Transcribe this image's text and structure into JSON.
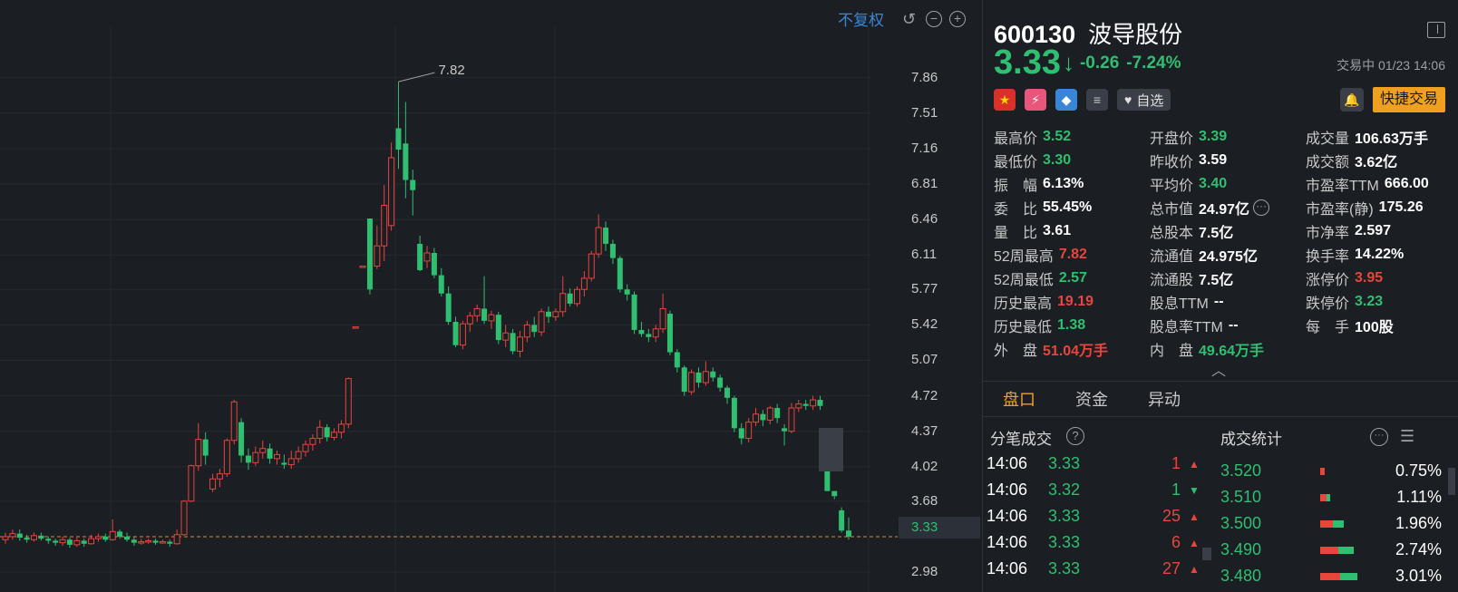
{
  "chart": {
    "no_adjust_label": "不复权",
    "reset_icon": "undo-icon",
    "zoom_out_icon": "minus-circle-icon",
    "zoom_in_icon": "plus-circle-icon",
    "price_axis": [
      "7.86",
      "7.51",
      "7.16",
      "6.81",
      "6.46",
      "6.11",
      "5.77",
      "5.42",
      "5.07",
      "4.72",
      "4.37",
      "4.02",
      "3.68",
      "2.98"
    ],
    "current_price_tag": "3.33",
    "high_marker_label": "7.82",
    "colors": {
      "up": "#e8453c",
      "down": "#2fbf71",
      "current_line": "#d48a3a",
      "grid": "#262a30"
    }
  },
  "chart_data": {
    "type": "candlestick",
    "y_range": [
      2.9,
      8.0
    ],
    "current_price": 3.33,
    "high_marker": 7.82,
    "candles": [
      {
        "o": 3.3,
        "c": 3.33,
        "h": 3.37,
        "l": 3.26
      },
      {
        "o": 3.33,
        "c": 3.36,
        "h": 3.4,
        "l": 3.3
      },
      {
        "o": 3.36,
        "c": 3.32,
        "h": 3.4,
        "l": 3.29
      },
      {
        "o": 3.32,
        "c": 3.3,
        "h": 3.35,
        "l": 3.27
      },
      {
        "o": 3.3,
        "c": 3.34,
        "h": 3.37,
        "l": 3.28
      },
      {
        "o": 3.34,
        "c": 3.31,
        "h": 3.37,
        "l": 3.29
      },
      {
        "o": 3.31,
        "c": 3.29,
        "h": 3.33,
        "l": 3.26
      },
      {
        "o": 3.29,
        "c": 3.27,
        "h": 3.31,
        "l": 3.24
      },
      {
        "o": 3.27,
        "c": 3.3,
        "h": 3.33,
        "l": 3.24
      },
      {
        "o": 3.3,
        "c": 3.25,
        "h": 3.32,
        "l": 3.22
      },
      {
        "o": 3.25,
        "c": 3.29,
        "h": 3.32,
        "l": 3.23
      },
      {
        "o": 3.29,
        "c": 3.26,
        "h": 3.31,
        "l": 3.23
      },
      {
        "o": 3.26,
        "c": 3.31,
        "h": 3.35,
        "l": 3.25
      },
      {
        "o": 3.31,
        "c": 3.33,
        "h": 3.36,
        "l": 3.28
      },
      {
        "o": 3.33,
        "c": 3.3,
        "h": 3.36,
        "l": 3.28
      },
      {
        "o": 3.3,
        "c": 3.38,
        "h": 3.5,
        "l": 3.29
      },
      {
        "o": 3.38,
        "c": 3.33,
        "h": 3.4,
        "l": 3.31
      },
      {
        "o": 3.33,
        "c": 3.3,
        "h": 3.37,
        "l": 3.28
      },
      {
        "o": 3.3,
        "c": 3.27,
        "h": 3.33,
        "l": 3.24
      },
      {
        "o": 3.27,
        "c": 3.28,
        "h": 3.31,
        "l": 3.25
      },
      {
        "o": 3.28,
        "c": 3.29,
        "h": 3.31,
        "l": 3.26
      },
      {
        "o": 3.29,
        "c": 3.27,
        "h": 3.31,
        "l": 3.25
      },
      {
        "o": 3.27,
        "c": 3.28,
        "h": 3.3,
        "l": 3.26
      },
      {
        "o": 3.28,
        "c": 3.26,
        "h": 3.3,
        "l": 3.23
      },
      {
        "o": 3.26,
        "c": 3.35,
        "h": 3.4,
        "l": 3.25
      },
      {
        "o": 3.35,
        "c": 3.68,
        "h": 3.69,
        "l": 3.34
      },
      {
        "o": 3.68,
        "c": 4.03,
        "h": 4.04,
        "l": 3.67
      },
      {
        "o": 4.03,
        "c": 4.29,
        "h": 4.45,
        "l": 3.98
      },
      {
        "o": 4.29,
        "c": 4.13,
        "h": 4.36,
        "l": 4.04
      },
      {
        "o": 3.8,
        "c": 3.9,
        "h": 3.95,
        "l": 3.77
      },
      {
        "o": 3.9,
        "c": 3.95,
        "h": 4.0,
        "l": 3.82
      },
      {
        "o": 3.95,
        "c": 4.28,
        "h": 4.3,
        "l": 3.92
      },
      {
        "o": 4.28,
        "c": 4.66,
        "h": 4.68,
        "l": 4.24
      },
      {
        "o": 4.46,
        "c": 4.13,
        "h": 4.5,
        "l": 4.06
      },
      {
        "o": 4.13,
        "c": 4.06,
        "h": 4.2,
        "l": 3.99
      },
      {
        "o": 4.06,
        "c": 4.16,
        "h": 4.22,
        "l": 4.03
      },
      {
        "o": 4.16,
        "c": 4.2,
        "h": 4.28,
        "l": 4.1
      },
      {
        "o": 4.2,
        "c": 4.1,
        "h": 4.25,
        "l": 4.05
      },
      {
        "o": 4.1,
        "c": 4.14,
        "h": 4.18,
        "l": 4.04
      },
      {
        "o": 4.06,
        "c": 4.04,
        "h": 4.14,
        "l": 4.0
      },
      {
        "o": 4.04,
        "c": 4.1,
        "h": 4.18,
        "l": 4.0
      },
      {
        "o": 4.1,
        "c": 4.17,
        "h": 4.22,
        "l": 4.06
      },
      {
        "o": 4.17,
        "c": 4.24,
        "h": 4.28,
        "l": 4.12
      },
      {
        "o": 4.24,
        "c": 4.3,
        "h": 4.34,
        "l": 4.18
      },
      {
        "o": 4.3,
        "c": 4.41,
        "h": 4.48,
        "l": 4.25
      },
      {
        "o": 4.41,
        "c": 4.31,
        "h": 4.44,
        "l": 4.27
      },
      {
        "o": 4.31,
        "c": 4.36,
        "h": 4.4,
        "l": 4.28
      },
      {
        "o": 4.36,
        "c": 4.44,
        "h": 4.48,
        "l": 4.3
      },
      {
        "o": 4.44,
        "c": 4.89,
        "h": 4.9,
        "l": 4.4
      },
      {
        "o": 5.4,
        "c": 5.4,
        "h": 5.4,
        "l": 5.4
      },
      {
        "o": 6.0,
        "c": 6.0,
        "h": 6.0,
        "l": 6.0
      },
      {
        "o": 6.47,
        "c": 5.77,
        "h": 6.47,
        "l": 5.72
      },
      {
        "o": 6.0,
        "c": 6.2,
        "h": 6.4,
        "l": 5.97
      },
      {
        "o": 6.2,
        "c": 6.6,
        "h": 6.8,
        "l": 6.05
      },
      {
        "o": 6.4,
        "c": 7.07,
        "h": 7.22,
        "l": 6.35
      },
      {
        "o": 7.36,
        "c": 7.15,
        "h": 7.82,
        "l": 6.96
      },
      {
        "o": 7.21,
        "c": 6.85,
        "h": 7.62,
        "l": 6.67
      },
      {
        "o": 6.85,
        "c": 6.75,
        "h": 6.95,
        "l": 6.5
      },
      {
        "o": 6.22,
        "c": 5.96,
        "h": 6.3,
        "l": 5.95
      },
      {
        "o": 6.05,
        "c": 6.13,
        "h": 6.2,
        "l": 5.98
      },
      {
        "o": 6.13,
        "c": 5.91,
        "h": 6.18,
        "l": 5.88
      },
      {
        "o": 5.91,
        "c": 5.73,
        "h": 5.98,
        "l": 5.7
      },
      {
        "o": 5.73,
        "c": 5.45,
        "h": 5.8,
        "l": 5.42
      },
      {
        "o": 5.45,
        "c": 5.22,
        "h": 5.5,
        "l": 5.2
      },
      {
        "o": 5.22,
        "c": 5.43,
        "h": 5.46,
        "l": 5.18
      },
      {
        "o": 5.43,
        "c": 5.51,
        "h": 5.55,
        "l": 5.35
      },
      {
        "o": 5.51,
        "c": 5.58,
        "h": 5.62,
        "l": 5.45
      },
      {
        "o": 5.58,
        "c": 5.46,
        "h": 5.9,
        "l": 5.43
      },
      {
        "o": 5.46,
        "c": 5.52,
        "h": 5.56,
        "l": 5.38
      },
      {
        "o": 5.52,
        "c": 5.27,
        "h": 5.55,
        "l": 5.23
      },
      {
        "o": 5.27,
        "c": 5.34,
        "h": 5.42,
        "l": 5.2
      },
      {
        "o": 5.34,
        "c": 5.16,
        "h": 5.38,
        "l": 5.13
      },
      {
        "o": 5.16,
        "c": 5.3,
        "h": 5.36,
        "l": 5.1
      },
      {
        "o": 5.3,
        "c": 5.42,
        "h": 5.46,
        "l": 5.25
      },
      {
        "o": 5.42,
        "c": 5.35,
        "h": 5.5,
        "l": 5.3
      },
      {
        "o": 5.35,
        "c": 5.55,
        "h": 5.58,
        "l": 5.31
      },
      {
        "o": 5.55,
        "c": 5.5,
        "h": 5.6,
        "l": 5.44
      },
      {
        "o": 5.5,
        "c": 5.55,
        "h": 5.58,
        "l": 5.46
      },
      {
        "o": 5.55,
        "c": 5.73,
        "h": 5.9,
        "l": 5.5
      },
      {
        "o": 5.73,
        "c": 5.63,
        "h": 5.78,
        "l": 5.6
      },
      {
        "o": 5.63,
        "c": 5.77,
        "h": 5.8,
        "l": 5.6
      },
      {
        "o": 5.77,
        "c": 5.88,
        "h": 5.95,
        "l": 5.7
      },
      {
        "o": 5.88,
        "c": 6.12,
        "h": 6.15,
        "l": 5.85
      },
      {
        "o": 6.12,
        "c": 6.38,
        "h": 6.51,
        "l": 6.08
      },
      {
        "o": 6.38,
        "c": 6.22,
        "h": 6.44,
        "l": 6.15
      },
      {
        "o": 6.22,
        "c": 6.08,
        "h": 6.26,
        "l": 6.02
      },
      {
        "o": 6.08,
        "c": 5.77,
        "h": 6.1,
        "l": 5.74
      },
      {
        "o": 5.77,
        "c": 5.72,
        "h": 5.82,
        "l": 5.66
      },
      {
        "o": 5.72,
        "c": 5.37,
        "h": 5.75,
        "l": 5.33
      },
      {
        "o": 5.37,
        "c": 5.33,
        "h": 5.45,
        "l": 5.3
      },
      {
        "o": 5.33,
        "c": 5.3,
        "h": 5.38,
        "l": 5.25
      },
      {
        "o": 5.3,
        "c": 5.38,
        "h": 5.42,
        "l": 5.25
      },
      {
        "o": 5.38,
        "c": 5.58,
        "h": 5.73,
        "l": 5.34
      },
      {
        "o": 5.53,
        "c": 5.15,
        "h": 5.56,
        "l": 5.12
      },
      {
        "o": 5.15,
        "c": 5.0,
        "h": 5.18,
        "l": 4.95
      },
      {
        "o": 5.0,
        "c": 4.76,
        "h": 5.02,
        "l": 4.72
      },
      {
        "o": 4.76,
        "c": 4.95,
        "h": 4.98,
        "l": 4.73
      },
      {
        "o": 4.95,
        "c": 4.85,
        "h": 5.0,
        "l": 4.8
      },
      {
        "o": 4.85,
        "c": 4.96,
        "h": 5.06,
        "l": 4.82
      },
      {
        "o": 4.96,
        "c": 4.9,
        "h": 5.0,
        "l": 4.86
      },
      {
        "o": 4.9,
        "c": 4.8,
        "h": 4.93,
        "l": 4.76
      },
      {
        "o": 4.8,
        "c": 4.7,
        "h": 4.82,
        "l": 4.64
      },
      {
        "o": 4.7,
        "c": 4.4,
        "h": 4.72,
        "l": 4.36
      },
      {
        "o": 4.4,
        "c": 4.3,
        "h": 4.45,
        "l": 4.24
      },
      {
        "o": 4.3,
        "c": 4.46,
        "h": 4.5,
        "l": 4.26
      },
      {
        "o": 4.46,
        "c": 4.54,
        "h": 4.6,
        "l": 4.42
      },
      {
        "o": 4.54,
        "c": 4.48,
        "h": 4.58,
        "l": 4.42
      },
      {
        "o": 4.48,
        "c": 4.6,
        "h": 4.62,
        "l": 4.44
      },
      {
        "o": 4.6,
        "c": 4.5,
        "h": 4.64,
        "l": 4.45
      },
      {
        "o": 4.4,
        "c": 4.37,
        "h": 4.44,
        "l": 4.23
      },
      {
        "o": 4.37,
        "c": 4.6,
        "h": 4.65,
        "l": 4.35
      },
      {
        "o": 4.6,
        "c": 4.64,
        "h": 4.68,
        "l": 4.56
      },
      {
        "o": 4.64,
        "c": 4.62,
        "h": 4.68,
        "l": 4.58
      },
      {
        "o": 4.62,
        "c": 4.68,
        "h": 4.72,
        "l": 4.58
      },
      {
        "o": 4.68,
        "c": 4.62,
        "h": 4.72,
        "l": 4.58
      },
      {
        "o": 4.24,
        "c": 3.78,
        "h": 4.24,
        "l": 3.78
      },
      {
        "o": 3.78,
        "c": 3.73,
        "h": 3.78,
        "l": 3.7
      },
      {
        "o": 3.59,
        "c": 3.39,
        "h": 3.62,
        "l": 3.37
      },
      {
        "o": 3.39,
        "c": 3.33,
        "h": 3.52,
        "l": 3.3
      }
    ]
  },
  "quote": {
    "code": "600130",
    "name": "波导股份",
    "price": "3.33",
    "change": "-0.26",
    "change_pct": "-7.24%",
    "status": "交易中 01/23 14:06",
    "watch_label": "自选",
    "quick_trade_label": "快捷交易",
    "icons": {
      "collapse": "panel-collapse-icon",
      "flag": "china-flag-icon",
      "bolt": "lightning-icon",
      "tag": "price-tag-icon",
      "doc": "document-icon",
      "heart": "heart-icon",
      "bell": "bell-icon"
    }
  },
  "stats": [
    [
      {
        "label": "最高价",
        "value": "3.52",
        "color": "green"
      },
      {
        "label": "开盘价",
        "value": "3.39",
        "color": "green"
      },
      {
        "label": "成交量",
        "value": "106.63万手",
        "color": "white"
      }
    ],
    [
      {
        "label": "最低价",
        "value": "3.30",
        "color": "green"
      },
      {
        "label": "昨收价",
        "value": "3.59",
        "color": "white"
      },
      {
        "label": "成交额",
        "value": "3.62亿",
        "color": "white"
      }
    ],
    [
      {
        "label": "振　幅",
        "value": "6.13%",
        "color": "white"
      },
      {
        "label": "平均价",
        "value": "3.40",
        "color": "green"
      },
      {
        "label": "市盈率TTM",
        "value": "666.00",
        "color": "white"
      }
    ],
    [
      {
        "label": "委　比",
        "value": "55.45%",
        "color": "white"
      },
      {
        "label": "总市值",
        "value": "24.97亿",
        "color": "white",
        "more": true
      },
      {
        "label": "市盈率(静)",
        "value": "175.26",
        "color": "white"
      }
    ],
    [
      {
        "label": "量　比",
        "value": "3.61",
        "color": "white"
      },
      {
        "label": "总股本",
        "value": "7.5亿",
        "color": "white"
      },
      {
        "label": "市净率",
        "value": "2.597",
        "color": "white"
      }
    ],
    [
      {
        "label": "52周最高",
        "value": "7.82",
        "color": "red"
      },
      {
        "label": "流通值",
        "value": "24.975亿",
        "color": "white"
      },
      {
        "label": "换手率",
        "value": "14.22%",
        "color": "white"
      }
    ],
    [
      {
        "label": "52周最低",
        "value": "2.57",
        "color": "green"
      },
      {
        "label": "流通股",
        "value": "7.5亿",
        "color": "white"
      },
      {
        "label": "涨停价",
        "value": "3.95",
        "color": "red"
      }
    ],
    [
      {
        "label": "历史最高",
        "value": "19.19",
        "color": "red"
      },
      {
        "label": "股息TTM",
        "value": "--",
        "color": "white"
      },
      {
        "label": "跌停价",
        "value": "3.23",
        "color": "green"
      }
    ],
    [
      {
        "label": "历史最低",
        "value": "1.38",
        "color": "green"
      },
      {
        "label": "股息率TTM",
        "value": "--",
        "color": "white"
      },
      {
        "label": "每　手",
        "value": "100股",
        "color": "white"
      }
    ],
    [
      {
        "label": "外　盘",
        "value": "51.04万手",
        "color": "red"
      },
      {
        "label": "内　盘",
        "value": "49.64万手",
        "color": "green"
      },
      {
        "label": "",
        "value": "",
        "color": "white"
      }
    ]
  ],
  "tabs": [
    "盘口",
    "资金",
    "异动"
  ],
  "ticks": {
    "title": "分笔成交",
    "rows": [
      {
        "time": "14:06",
        "price": "3.33",
        "vol": "1",
        "dir": "up"
      },
      {
        "time": "14:06",
        "price": "3.32",
        "vol": "1",
        "dir": "down"
      },
      {
        "time": "14:06",
        "price": "3.33",
        "vol": "25",
        "dir": "up"
      },
      {
        "time": "14:06",
        "price": "3.33",
        "vol": "6",
        "dir": "up"
      },
      {
        "time": "14:06",
        "price": "3.33",
        "vol": "27",
        "dir": "up"
      }
    ]
  },
  "volume_stats": {
    "title": "成交统计",
    "rows": [
      {
        "price": "3.520",
        "pct": "0.75%",
        "red": 0.04,
        "green": 0.0
      },
      {
        "price": "3.510",
        "pct": "1.11%",
        "red": 0.06,
        "green": 0.03
      },
      {
        "price": "3.500",
        "pct": "1.96%",
        "red": 0.12,
        "green": 0.1
      },
      {
        "price": "3.490",
        "pct": "2.74%",
        "red": 0.17,
        "green": 0.14
      },
      {
        "price": "3.480",
        "pct": "3.01%",
        "red": 0.18,
        "green": 0.16
      }
    ]
  }
}
